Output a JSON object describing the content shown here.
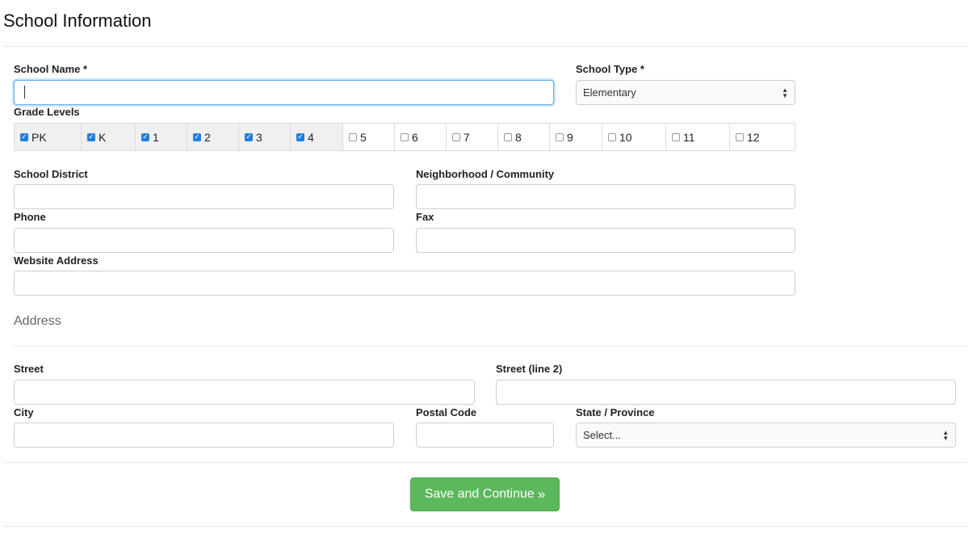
{
  "page_title": "School Information",
  "school_name": {
    "label": "School Name *",
    "value": ""
  },
  "school_type": {
    "label": "School Type *",
    "value": "Elementary"
  },
  "grade_levels": {
    "label": "Grade Levels",
    "items": [
      {
        "label": "PK",
        "checked": true
      },
      {
        "label": "K",
        "checked": true
      },
      {
        "label": "1",
        "checked": true
      },
      {
        "label": "2",
        "checked": true
      },
      {
        "label": "3",
        "checked": true
      },
      {
        "label": "4",
        "checked": true
      },
      {
        "label": "5",
        "checked": false
      },
      {
        "label": "6",
        "checked": false
      },
      {
        "label": "7",
        "checked": false
      },
      {
        "label": "8",
        "checked": false
      },
      {
        "label": "9",
        "checked": false
      },
      {
        "label": "10",
        "checked": false
      },
      {
        "label": "11",
        "checked": false
      },
      {
        "label": "12",
        "checked": false
      }
    ]
  },
  "school_district": {
    "label": "School District",
    "value": ""
  },
  "neighborhood": {
    "label": "Neighborhood / Community",
    "value": ""
  },
  "phone": {
    "label": "Phone",
    "value": ""
  },
  "fax": {
    "label": "Fax",
    "value": ""
  },
  "website": {
    "label": "Website Address",
    "value": ""
  },
  "address_section": "Address",
  "street": {
    "label": "Street",
    "value": ""
  },
  "street2": {
    "label": "Street (line 2)",
    "value": ""
  },
  "city": {
    "label": "City",
    "value": ""
  },
  "postal_code": {
    "label": "Postal Code",
    "value": ""
  },
  "state": {
    "label": "State / Province",
    "value": "Select..."
  },
  "save_button": {
    "label": "Save and Continue",
    "icon": "double-chevron-right-icon"
  },
  "colors": {
    "accent_green": "#5cb85c",
    "checkbox_blue": "#1e7fe0",
    "focus_blue": "#66afe9"
  }
}
